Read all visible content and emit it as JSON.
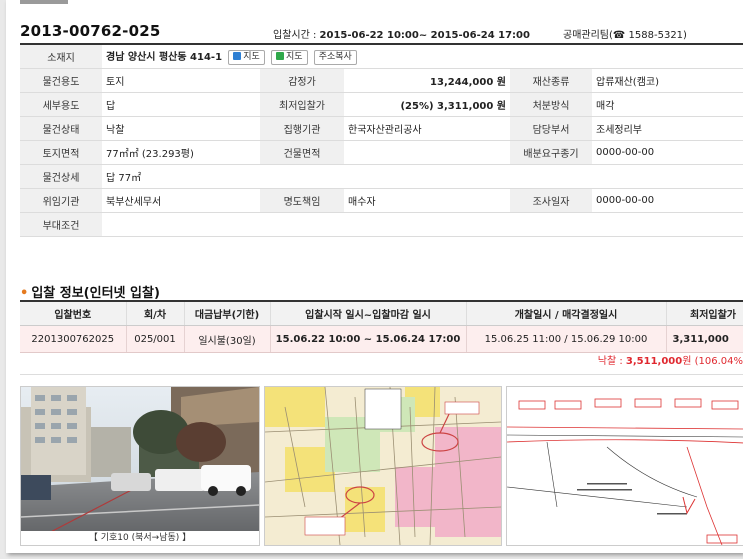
{
  "header": {
    "case_no": "2013-00762-025",
    "bid_period_label": "입찰시간 :",
    "bid_period": "2015-06-22 10:00~ 2015-06-24 17:00",
    "team": "공매관리팀(☎ 1588-5321)"
  },
  "info": {
    "location_label": "소재지",
    "location": "경남 양산시 평산동 414-1",
    "map_btn1": "지도",
    "map_btn2": "지도",
    "copy_btn": "주소복사",
    "rows": [
      {
        "l1": "물건용도",
        "v1": "토지",
        "l2": "감정가",
        "v2": "13,244,000 원",
        "l3": "재산종류",
        "v3": "압류재산(캠코)"
      },
      {
        "l1": "세부용도",
        "v1": "답",
        "l2": "최저입찰가",
        "v2": "(25%) 3,311,000 원",
        "l3": "처분방식",
        "v3": "매각"
      },
      {
        "l1": "물건상태",
        "v1": "낙찰",
        "l2": "집행기관",
        "v2": "한국자산관리공사",
        "l3": "담당부서",
        "v3": "조세정리부"
      },
      {
        "l1": "토지면적",
        "v1": "77㎡㎡ (23.293평)",
        "l2": "건물면적",
        "v2": "",
        "l3": "배분요구종기",
        "v3": "0000-00-00"
      }
    ],
    "detail_label": "물건상세",
    "detail": "답 77㎡",
    "delegate_label": "위임기관",
    "delegate": "북부산세무서",
    "title_label": "명도책임",
    "title": "매수자",
    "survey_label": "조사일자",
    "survey": "0000-00-00",
    "cond_label": "부대조건",
    "cond": ""
  },
  "bid_section": {
    "title": "입찰 정보(인터넷 입찰)",
    "headers": [
      "입찰번호",
      "회/차",
      "대금납부(기한)",
      "입찰시작 일시~입찰마감 일시",
      "개찰일시 / 매각결정일시",
      "최저입찰가"
    ],
    "row": [
      "2201300762025",
      "025/001",
      "일시불(30일)",
      "15.06.22 10:00 ~ 15.06.24 17:00",
      "15.06.25 11:00 / 15.06.29 10:00",
      "3,311,000"
    ],
    "result_label": "낙찰 : ",
    "result_value": "3,511,000",
    "result_unit": "원 (106.04%"
  },
  "photos": {
    "caption1": "【 기호10 (북서→남동) 】"
  },
  "colors": {
    "accent_red": "#e0282f",
    "accent_blue": "#2a6fb0",
    "row_pink": "#fdeeee"
  }
}
